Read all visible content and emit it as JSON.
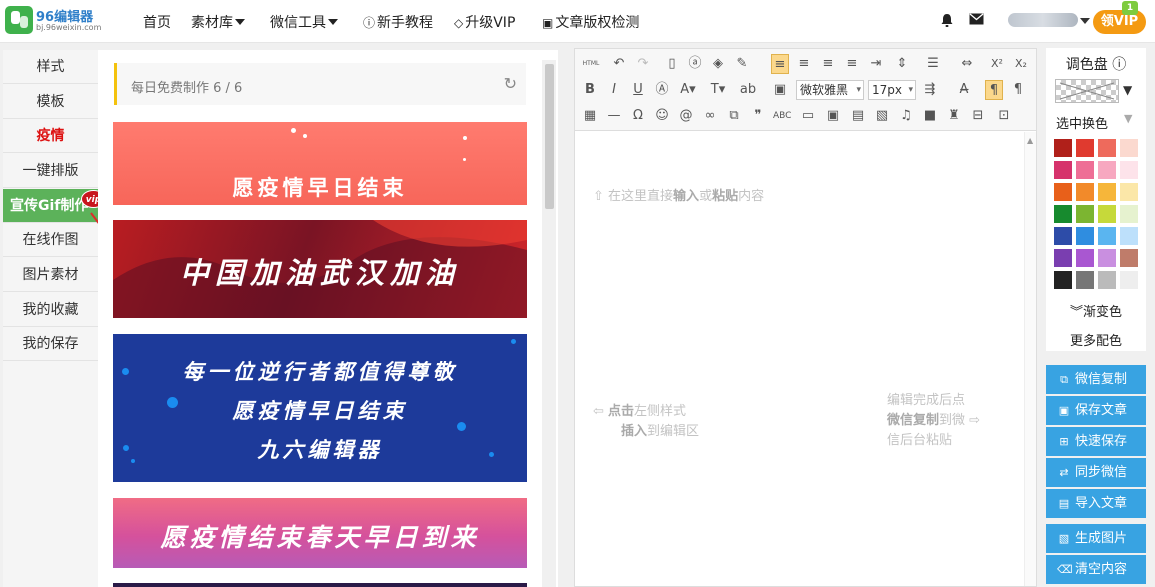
{
  "brand": {
    "name": "96编辑器",
    "url": "bj.96weixin.com"
  },
  "nav": {
    "items": [
      {
        "label": "首页",
        "caret": false
      },
      {
        "label": "素材库",
        "caret": true
      },
      {
        "label": "微信工具",
        "caret": true
      },
      {
        "label": "新手教程",
        "icon": "question-circle-icon"
      },
      {
        "label": "升级VIP",
        "icon": "diamond-icon"
      },
      {
        "label": "文章版权检测",
        "icon": "calendar-check-icon"
      }
    ],
    "vip_button": "领VIP",
    "vip_flag": "1"
  },
  "sidebar": {
    "items": [
      {
        "label": "样式"
      },
      {
        "label": "模板"
      },
      {
        "label": "疫情"
      },
      {
        "label": "一键排版"
      },
      {
        "label": "宣传Gif制作"
      },
      {
        "label": "在线作图"
      },
      {
        "label": "图片素材"
      },
      {
        "label": "我的收藏"
      },
      {
        "label": "我的保存"
      }
    ],
    "vip_badge": "vip"
  },
  "templates": {
    "free_bar": "每日免费制作 6 / 6",
    "banners": [
      {
        "text": "愿疫情早日结束"
      },
      {
        "text": "中国加油武汉加油"
      },
      {
        "lines": [
          "每一位逆行者都值得尊敬",
          "愿疫情早日结束",
          "九六编辑器"
        ]
      },
      {
        "text": "愿疫情结束春天早日到来"
      }
    ]
  },
  "editor": {
    "toolbar": {
      "html_label": "HTML",
      "font": "微软雅黑",
      "size": "17px"
    },
    "hint_top": {
      "pre": "在这里直接",
      "b1": "输入",
      "mid": "或",
      "b2": "粘贴",
      "post": "内容"
    },
    "hint_left": {
      "b1": "点击",
      "t1": "左侧样式",
      "b2": "插入",
      "t2": "到编辑区"
    },
    "hint_right": {
      "t1": "编辑完成后点",
      "b1": "微信复制",
      "t2": "到微",
      "t3": "信后台粘贴"
    }
  },
  "palette": {
    "title": "调色盘",
    "subtitle": "选中换色",
    "gradient_link": "渐变色",
    "more_link": "更多配色",
    "colors": [
      "#b0201a",
      "#e03a2f",
      "#ee6a5c",
      "#fbd9cf",
      "#d6336c",
      "#ee6e96",
      "#f7a8c0",
      "#fde3ea",
      "#e8601a",
      "#f28a2a",
      "#f6b63a",
      "#fbe7a8",
      "#178a2e",
      "#7cb531",
      "#c6d93a",
      "#e6f2cf",
      "#2d4ca8",
      "#2f8de0",
      "#5ab5f0",
      "#bde0fb",
      "#7a3eb0",
      "#a957d1",
      "#c98fe0",
      "#bf7c6a",
      "#222222",
      "#777777",
      "#bbbbbb",
      "#eeeeee"
    ]
  },
  "actions": [
    {
      "label": "微信复制",
      "icon": "copy-icon"
    },
    {
      "label": "保存文章",
      "icon": "save-icon"
    },
    {
      "label": "快速保存",
      "icon": "plus-square-icon"
    },
    {
      "label": "同步微信",
      "icon": "sync-icon"
    },
    {
      "label": "导入文章",
      "icon": "import-icon"
    },
    {
      "label": "生成图片",
      "icon": "image-file-icon"
    },
    {
      "label": "清空内容",
      "icon": "trash-icon"
    }
  ],
  "colors": {
    "accent_green": "#5cb25a",
    "action_blue": "#38a3e2",
    "vip_orange": "#f49a12"
  }
}
